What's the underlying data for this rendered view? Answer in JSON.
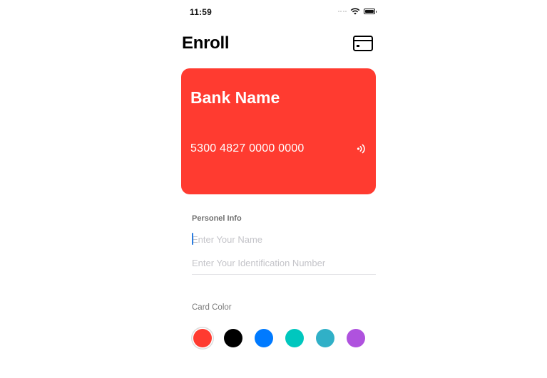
{
  "status_bar": {
    "time": "11:59",
    "icons": [
      "signal-icon",
      "wifi-icon",
      "battery-icon"
    ]
  },
  "header": {
    "title": "Enroll",
    "action_icon": "credit-card-icon"
  },
  "card": {
    "bank_name": "Bank Name",
    "number": "5300 4827 0000 0000",
    "contactless_icon": "contactless-icon",
    "color": "#ff3b30"
  },
  "personal_info": {
    "section_label": "Personel Info",
    "name_field": {
      "value": "",
      "placeholder": "Enter Your Name"
    },
    "id_field": {
      "value": "",
      "placeholder": "Enter Your Identification Number"
    }
  },
  "card_color": {
    "section_label": "Card Color",
    "selected_index": 0,
    "options": [
      {
        "name": "red",
        "hex": "#ff3b30"
      },
      {
        "name": "black",
        "hex": "#000000"
      },
      {
        "name": "blue",
        "hex": "#007aff"
      },
      {
        "name": "teal",
        "hex": "#00c7be"
      },
      {
        "name": "cyan",
        "hex": "#30b0c7"
      },
      {
        "name": "purple",
        "hex": "#af52de"
      }
    ]
  }
}
